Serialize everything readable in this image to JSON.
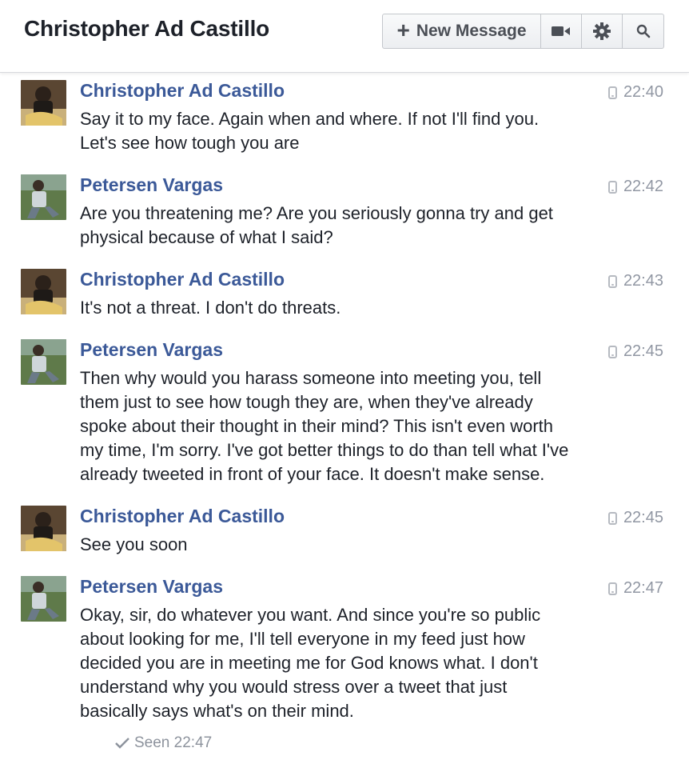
{
  "header": {
    "title": "Christopher Ad Castillo",
    "new_message_label": "New Message",
    "icons": [
      "plus-icon",
      "video-icon",
      "gear-icon",
      "search-icon"
    ]
  },
  "messages": [
    {
      "sender": "Christopher Ad Castillo",
      "time": "22:40",
      "lines": [
        "Say it to my face. Again when and where. If not I'll find you.",
        "Let's see how tough you are"
      ]
    },
    {
      "sender": "Petersen Vargas",
      "time": "22:42",
      "lines": [
        "Are you threatening me? Are you seriously gonna try and get",
        "physical because of what I said?"
      ]
    },
    {
      "sender": "Christopher Ad Castillo",
      "time": "22:43",
      "lines": [
        "It's not a threat. I don't do threats."
      ]
    },
    {
      "sender": "Petersen Vargas",
      "time": "22:45",
      "lines": [
        "Then why would you harass someone into meeting you, tell",
        "them just to see how tough they are, when they've already",
        "spoke about their thought in their mind? This isn't even worth",
        "my time, I'm sorry. I've got better things to do than tell what I've",
        "already tweeted in front of your face. It doesn't make sense."
      ]
    },
    {
      "sender": "Christopher Ad Castillo",
      "time": "22:45",
      "lines": [
        "See you soon"
      ]
    },
    {
      "sender": "Petersen Vargas",
      "time": "22:47",
      "lines": [
        "Okay, sir, do whatever you want. And since you're so public",
        "about looking for me, I'll tell everyone in my feed just how",
        "decided you are in meeting me for God knows what. I don't",
        "understand why you would stress over a tweet that just",
        "basically says what's on their mind."
      ]
    }
  ],
  "seen": "Seen 22:47",
  "colors": {
    "sender_name": "#3b5998",
    "timestamp": "#9197a3"
  }
}
